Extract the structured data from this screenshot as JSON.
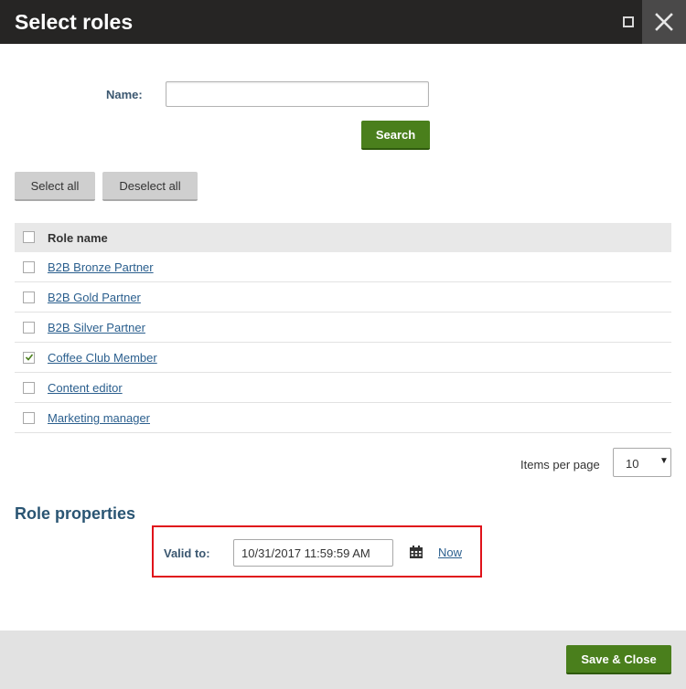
{
  "window": {
    "title": "Select roles",
    "maximize_icon": "maximize-icon",
    "close_icon": "close-icon"
  },
  "search": {
    "name_label": "Name:",
    "name_value": "",
    "search_label": "Search"
  },
  "selection": {
    "select_all_label": "Select all",
    "deselect_all_label": "Deselect all"
  },
  "grid": {
    "header": "Role name",
    "rows": [
      {
        "name": "B2B Bronze Partner",
        "checked": false
      },
      {
        "name": "B2B Gold Partner",
        "checked": false
      },
      {
        "name": "B2B Silver Partner",
        "checked": false
      },
      {
        "name": "Coffee Club Member",
        "checked": true
      },
      {
        "name": "Content editor",
        "checked": false
      },
      {
        "name": "Marketing manager",
        "checked": false
      }
    ]
  },
  "pager": {
    "items_per_page_label": "Items per page",
    "items_per_page_value": "10"
  },
  "properties": {
    "title": "Role properties",
    "valid_to_label": "Valid to:",
    "valid_to_value": "10/31/2017 11:59:59 AM",
    "calendar_icon": "calendar-icon",
    "now_label": "Now"
  },
  "footer": {
    "save_close_label": "Save & Close"
  },
  "colors": {
    "titlebar": "#262524",
    "primary_button": "#4a7f1c",
    "link": "#2b5f8e",
    "highlight": "#e0121a"
  }
}
